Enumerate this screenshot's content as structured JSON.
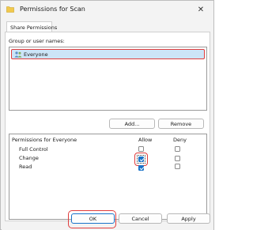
{
  "window": {
    "title": "Permissions for Scan",
    "close_glyph": "✕"
  },
  "tab": {
    "label": "Share Permissions"
  },
  "group_section": {
    "label": "Group or user names:",
    "items": [
      {
        "name": "Everyone",
        "icon": "group-users-icon",
        "selected": true
      }
    ],
    "add_label": "Add...",
    "remove_label": "Remove"
  },
  "permissions": {
    "header": "Permissions for Everyone",
    "allow_header": "Allow",
    "deny_header": "Deny",
    "rows": [
      {
        "label": "Full Control",
        "allow": false,
        "deny": false
      },
      {
        "label": "Change",
        "allow": true,
        "deny": false
      },
      {
        "label": "Read",
        "allow": true,
        "deny": false
      }
    ]
  },
  "buttons": {
    "ok": "OK",
    "cancel": "Cancel",
    "apply": "Apply"
  },
  "colors": {
    "highlight_ring": "#e03c3c",
    "selection": "#cce4f7",
    "checkbox_checked": "#1a73c9"
  }
}
